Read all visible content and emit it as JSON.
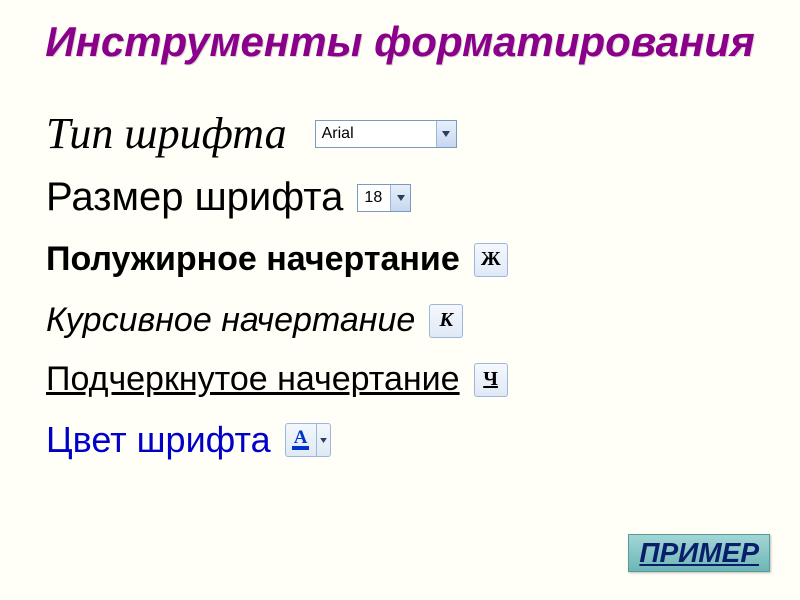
{
  "title": "Инструменты форматирования",
  "rows": {
    "fontType": {
      "label": "Тип шрифта",
      "value": "Arial"
    },
    "fontSize": {
      "label": "Размер шрифта",
      "value": "18"
    },
    "bold": {
      "label": "Полужирное начертание",
      "glyph": "Ж"
    },
    "italic": {
      "label": "Курсивное начертание",
      "glyph": "К"
    },
    "underline": {
      "label": "Подчеркнутое начертание",
      "glyph": "Ч"
    },
    "color": {
      "label": "Цвет шрифта",
      "glyph": "А",
      "swatch": "#0033cc"
    }
  },
  "exampleButton": "ПРИМЕР"
}
